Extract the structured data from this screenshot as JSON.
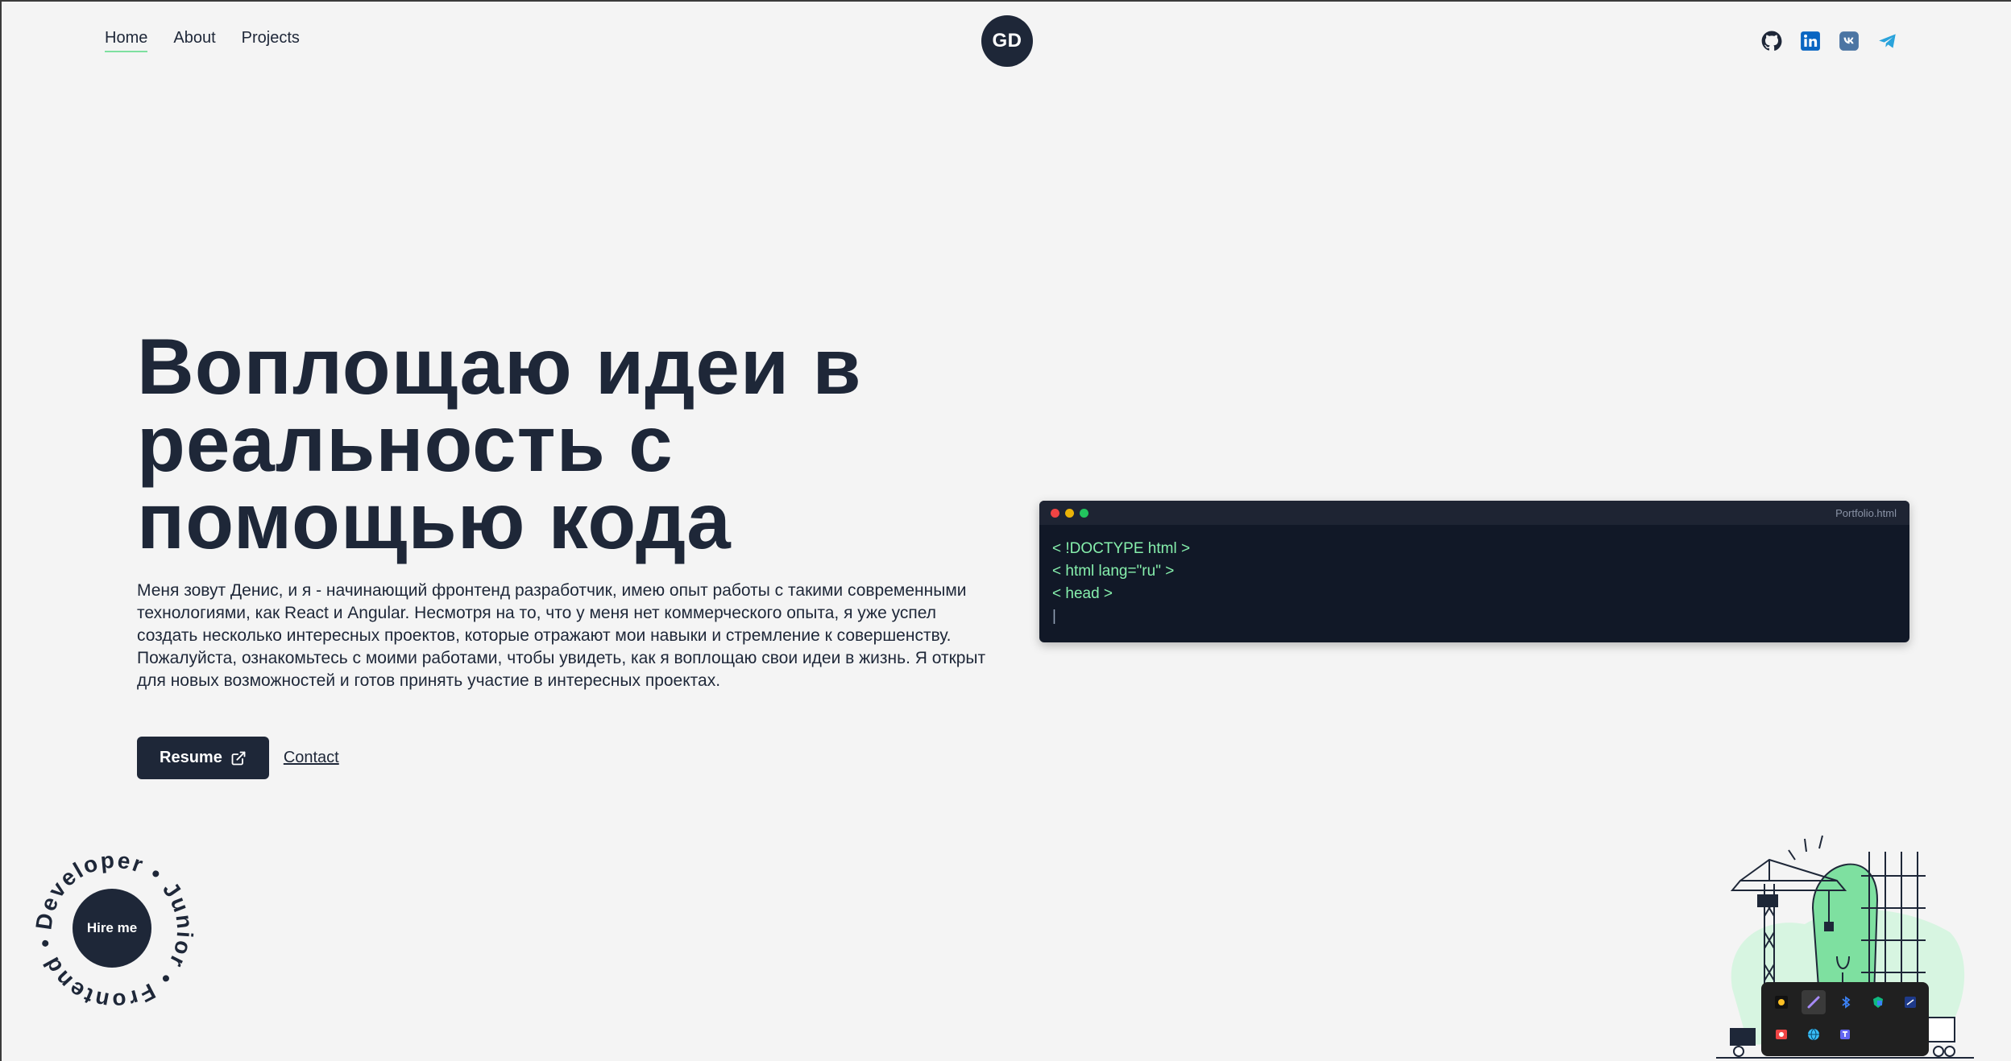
{
  "nav": {
    "links": [
      {
        "label": "Home",
        "active": true
      },
      {
        "label": "About",
        "active": false
      },
      {
        "label": "Projects",
        "active": false
      }
    ],
    "logo": "GD",
    "socials": [
      "github-icon",
      "linkedin-icon",
      "vk-icon",
      "telegram-icon"
    ]
  },
  "hero": {
    "title_lines": [
      "Воплощаю идеи в",
      "реальность с",
      "помощью кода"
    ],
    "description": "Меня зовут Денис, и я - начинающий фронтенд разработчик, имею опыт работы с такими современными технологиями, как React и Angular. Несмотря на то, что у меня нет коммерческого опыта, я уже успел создать несколько интересных проектов, которые отражают мои навыки и стремление к совершенству. Пожалуйста, ознакомьтесь с моими работами, чтобы увидеть, как я воплощаю свои идеи в жизнь. Я открыт для новых возможностей и готов принять участие в интересных проектах.",
    "resume_label": "Resume",
    "contact_label": "Contact"
  },
  "code_window": {
    "filename": "Portfolio.html",
    "lines": [
      "< !DOCTYPE html >",
      "< html lang=\"ru\" >",
      "< head >"
    ],
    "cursor": "|"
  },
  "badge": {
    "ring_text": "Developer • Junior • Frontend •",
    "button_label": "Hire me"
  },
  "tray": {
    "icons": [
      "sun-app-icon",
      "pen-app-icon",
      "bluetooth-icon",
      "shield-app-icon",
      "monitor-app-icon",
      "record-app-icon",
      "globe-app-icon",
      "teams-app-icon"
    ]
  },
  "colors": {
    "background": "#f4f4f4",
    "primary": "#1e2738",
    "accent_green": "#7ee0a0",
    "code_bg": "#111827",
    "code_text": "#86efac"
  }
}
